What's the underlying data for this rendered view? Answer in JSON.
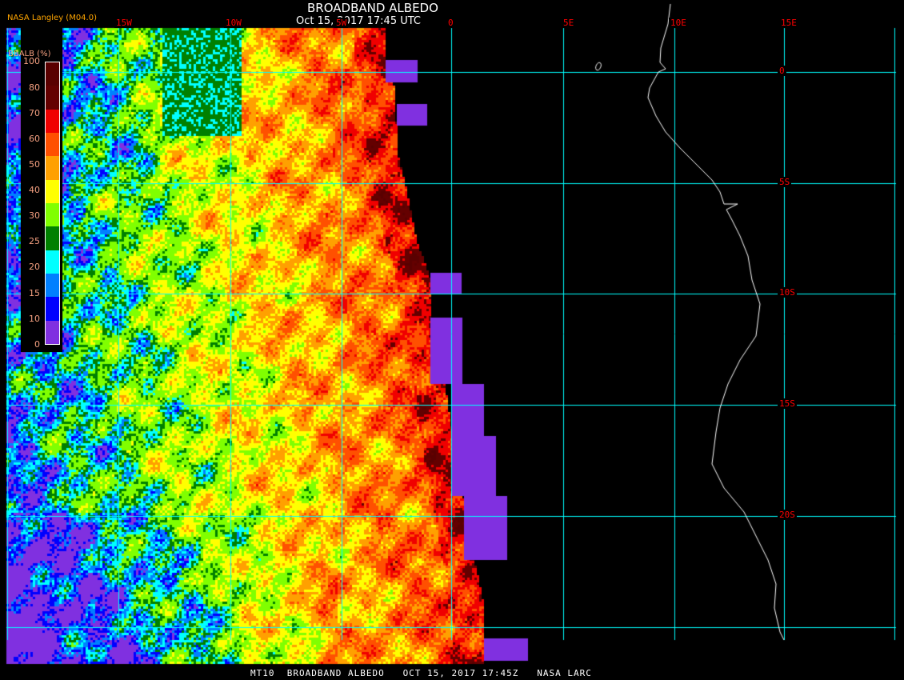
{
  "header": {
    "title": "BROADBAND ALBEDO",
    "datetime": "Oct 15, 2017 17:45 UTC",
    "org": "NASA Langley (M04.0)"
  },
  "legend": {
    "title": "BBALB (%)",
    "labels": [
      "100",
      "80",
      "70",
      "60",
      "50",
      "40",
      "30",
      "25",
      "20",
      "15",
      "10",
      "0"
    ],
    "bins": [
      {
        "min": 90,
        "max": 100,
        "color": "#5a0000"
      },
      {
        "min": 80,
        "max": 90,
        "color": "#640000"
      },
      {
        "min": 70,
        "max": 80,
        "color": "#f00000"
      },
      {
        "min": 60,
        "max": 70,
        "color": "#ff5000"
      },
      {
        "min": 50,
        "max": 60,
        "color": "#ffa000"
      },
      {
        "min": 40,
        "max": 50,
        "color": "#ffff00"
      },
      {
        "min": 30,
        "max": 40,
        "color": "#80ff00"
      },
      {
        "min": 25,
        "max": 30,
        "color": "#008000"
      },
      {
        "min": 20,
        "max": 25,
        "color": "#00ffff"
      },
      {
        "min": 15,
        "max": 20,
        "color": "#0080ff"
      },
      {
        "min": 10,
        "max": 15,
        "color": "#0000ff"
      },
      {
        "min": 0,
        "max": 10,
        "color": "#8030e0"
      }
    ]
  },
  "grid": {
    "lon_labels": [
      "15W",
      "10W",
      "5W",
      "0",
      "5E",
      "10E",
      "15E"
    ],
    "lat_labels": [
      "0",
      "5S",
      "10S",
      "15S",
      "20S"
    ],
    "line_color": "#00ffff",
    "label_color": "#ff0000"
  },
  "footer": "MT10  BROADBAND ALBEDO   OCT 15, 2017 17:45Z   NASA LARC"
}
